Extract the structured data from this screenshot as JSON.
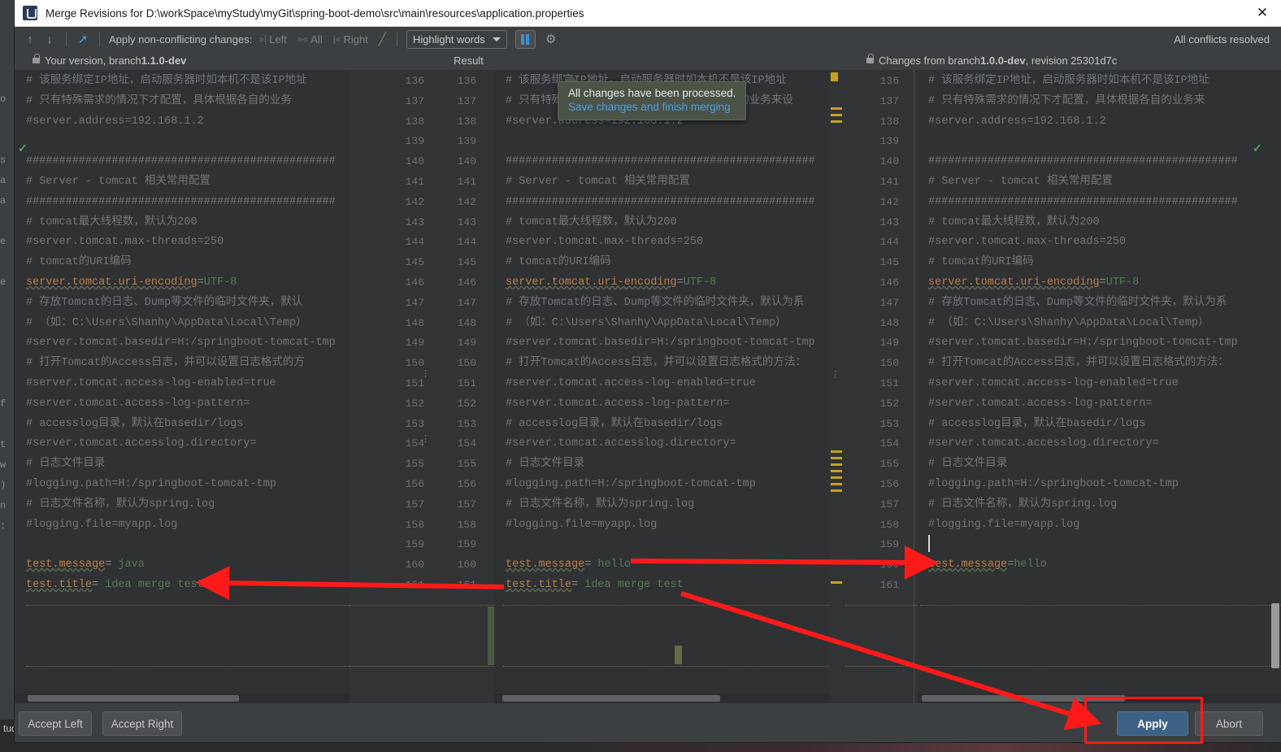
{
  "window": {
    "title": "Merge Revisions for D:\\workSpace\\myStudy\\myGit\\spring-boot-demo\\src\\main\\resources\\application.properties",
    "close_label": "✕",
    "app_icon": "intellij-idea-icon"
  },
  "toolbar": {
    "prev_diff_icon": "arrow-up-icon",
    "next_diff_icon": "arrow-down-icon",
    "apply_all_icon": "apply-non-conflicting-icon",
    "apply_label": "Apply non-conflicting changes:",
    "actions": [
      {
        "name": "left",
        "label": "Left",
        "glyph": "»|"
      },
      {
        "name": "all",
        "label": "All",
        "glyph": "»«"
      },
      {
        "name": "right",
        "label": "Right",
        "glyph": "|«"
      },
      {
        "name": "magic",
        "label": "",
        "glyph": "╱"
      }
    ],
    "highlight_select": "Highlight words",
    "whitespace_toggle_icon": "whitespace-toggle-icon",
    "settings_icon": "gear-icon",
    "conflicts_status": "All conflicts resolved"
  },
  "panes": {
    "left_header_prefix": "Your version, branch ",
    "left_header_branch": "1.1.0-dev",
    "middle_header": "Result",
    "right_header_prefix": "Changes from branch ",
    "right_header_branch": "1.0.0-dev",
    "right_header_suffix": ", revision 25301d7c"
  },
  "tooltip": {
    "line1": "All changes have been processed.",
    "line2": "Save changes and finish merging"
  },
  "line_numbers": [
    136,
    137,
    138,
    139,
    140,
    141,
    142,
    143,
    144,
    145,
    146,
    147,
    148,
    149,
    150,
    151,
    152,
    153,
    154,
    155,
    156,
    157,
    158,
    159,
    160,
    161
  ],
  "left_code": [
    "# 该服务绑定IP地址，启动服务器时如本机不是该IP地址",
    "# 只有特殊需求的情况下才配置，具体根据各自的业务",
    "#server.address=192.168.1.2",
    "",
    "###############################################",
    "# Server - tomcat 相关常用配置",
    "###############################################",
    "# tomcat最大线程数，默认为200",
    "#server.tomcat.max-threads=250",
    "# tomcat的URI编码",
    "server.tomcat.uri-encoding=UTF-8",
    "# 存放Tomcat的日志、Dump等文件的临时文件夹，默认",
    "# （如：C:\\Users\\Shanhy\\AppData\\Local\\Temp）",
    "#server.tomcat.basedir=H:/springboot-tomcat-tmp",
    "# 打开Tomcat的Access日志，并可以设置日志格式的方",
    "#server.tomcat.access-log-enabled=true",
    "#server.tomcat.access-log-pattern=",
    "# accesslog目录，默认在basedir/logs",
    "#server.tomcat.accesslog.directory=",
    "# 日志文件目录",
    "#logging.path=H:/springboot-tomcat-tmp",
    "# 日志文件名称，默认为spring.log",
    "#logging.file=myapp.log",
    "",
    "test.message= java",
    "test.title= idea merge test"
  ],
  "middle_code": [
    "# 该服务绑定IP地址，启动服务器时如本机不是该IP地址",
    "# 只有特殊需求的情况下才配置，具体根据各自的业务来设",
    "#server.address=192.168.1.2",
    "",
    "###############################################",
    "# Server - tomcat 相关常用配置",
    "###############################################",
    "# tomcat最大线程数，默认为200",
    "#server.tomcat.max-threads=250",
    "# tomcat的URI编码",
    "server.tomcat.uri-encoding=UTF-8",
    "# 存放Tomcat的日志、Dump等文件的临时文件夹，默认为系",
    "# （如：C:\\Users\\Shanhy\\AppData\\Local\\Temp）",
    "#server.tomcat.basedir=H:/springboot-tomcat-tmp",
    "# 打开Tomcat的Access日志，并可以设置日志格式的方法：",
    "#server.tomcat.access-log-enabled=true",
    "#server.tomcat.access-log-pattern=",
    "# accesslog目录，默认在basedir/logs",
    "#server.tomcat.accesslog.directory=",
    "# 日志文件目录",
    "#logging.path=H:/springboot-tomcat-tmp",
    "# 日志文件名称，默认为spring.log",
    "#logging.file=myapp.log",
    "",
    "test.message= hello",
    "test.title= idea merge test"
  ],
  "right_code": [
    "# 该服务绑定IP地址，启动服务器时如本机不是该IP地址",
    "# 只有特殊需求的情况下才配置，具体根据各自的业务来",
    "#server.address=192.168.1.2",
    "",
    "###############################################",
    "# Server - tomcat 相关常用配置",
    "###############################################",
    "# tomcat最大线程数，默认为200",
    "#server.tomcat.max-threads=250",
    "# tomcat的URI编码",
    "server.tomcat.uri-encoding=UTF-8",
    "# 存放Tomcat的日志、Dump等文件的临时文件夹，默认为系",
    "# （如：C:\\Users\\Shanhy\\AppData\\Local\\Temp）",
    "#server.tomcat.basedir=H:/springboot-tomcat-tmp",
    "# 打开Tomcat的Access日志，并可以设置日志格式的方法：",
    "#server.tomcat.access-log-enabled=true",
    "#server.tomcat.access-log-pattern=",
    "# accesslog目录，默认在basedir/logs",
    "#server.tomcat.accesslog.directory=",
    "# 日志文件目录",
    "#logging.path=H:/springboot-tomcat-tmp",
    "# 日志文件名称，默认为spring.log",
    "#logging.file=myapp.log",
    "",
    "test.message=hello",
    ""
  ],
  "right_line_numbers": [
    136,
    137,
    138,
    139,
    140,
    141,
    142,
    143,
    144,
    145,
    146,
    147,
    148,
    149,
    150,
    151,
    152,
    153,
    154,
    155,
    156,
    157,
    158,
    159,
    160,
    161
  ],
  "buttons": {
    "accept_left": "Accept Left",
    "accept_right": "Accept Right",
    "apply": "Apply",
    "abort": "Abort"
  },
  "background": {
    "path_text": "tudy\\myGit\\"
  },
  "colors": {
    "accent_blue": "#3d6185",
    "annotation_red": "#ff1a1a",
    "tooltip_bg": "#4b5246",
    "tooltip_link": "#4f9fe0",
    "marker_gold": "#c8a020",
    "resolved_green": "#4caf50"
  }
}
